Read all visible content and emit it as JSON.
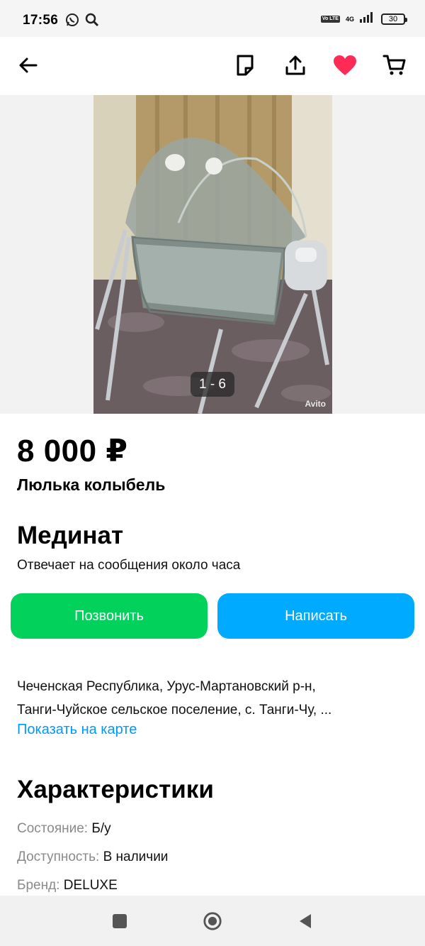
{
  "status_bar": {
    "time": "17:56",
    "left_icons": [
      "whatsapp-icon",
      "search-icon"
    ],
    "volte": "Vo LTE",
    "network": "4G",
    "battery": "30"
  },
  "toolbar": {
    "icons": [
      "back-arrow-icon",
      "note-icon",
      "share-icon",
      "favorite-heart-icon",
      "cart-icon"
    ],
    "favorite_color": "#ff2a55"
  },
  "gallery": {
    "counter": "1 - 6",
    "watermark": "Avito"
  },
  "listing": {
    "price": "8 000 ₽",
    "title": "Люлька колыбель"
  },
  "seller": {
    "name": "Мединат",
    "response": "Отвечает на сообщения около часа"
  },
  "actions": {
    "call": "Позвонить",
    "write": "Написать",
    "call_color": "#02d15c",
    "write_color": "#00aaff"
  },
  "location": {
    "address_line1": "Чеченская Республика, Урус-Мартановский р-н,",
    "address_line2": "Танги-Чуйское сельское поселение, с. Танги-Чу, ...",
    "map_link": "Показать на карте"
  },
  "characteristics": {
    "title": "Характеристики",
    "items": [
      {
        "key": "Состояние:",
        "value": "Б/у"
      },
      {
        "key": "Доступность:",
        "value": "В наличии"
      },
      {
        "key": "Бренд:",
        "value": "DELUXE"
      }
    ]
  },
  "navbar": {
    "icons": [
      "recent-apps-icon",
      "home-icon",
      "back-icon"
    ]
  }
}
